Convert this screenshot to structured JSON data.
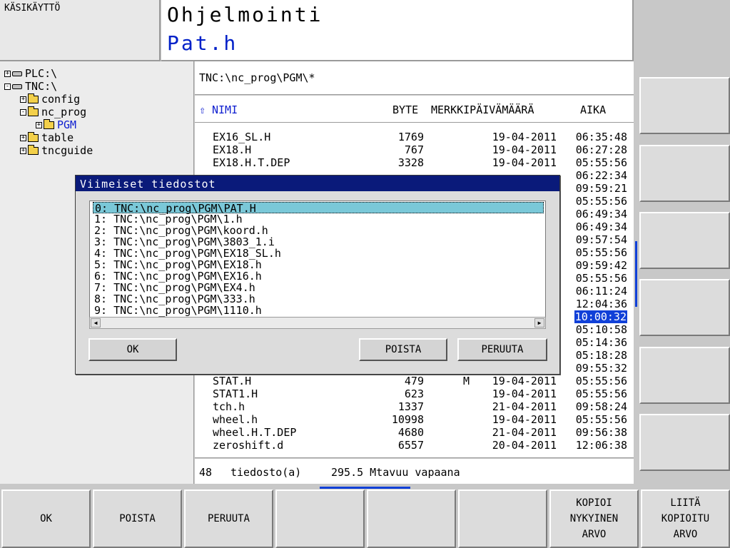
{
  "header": {
    "mode": "KÄSIKÄYTTÖ",
    "title": "Ohjelmointi",
    "subtitle": "Pat.h"
  },
  "tree": [
    {
      "label": "PLC:\\",
      "type": "drive",
      "level": 0,
      "toggle": "+"
    },
    {
      "label": "TNC:\\",
      "type": "drive",
      "level": 0,
      "toggle": "-"
    },
    {
      "label": "config",
      "type": "folder",
      "level": 1,
      "toggle": "+"
    },
    {
      "label": "nc_prog",
      "type": "folder",
      "level": 1,
      "toggle": "-"
    },
    {
      "label": "PGM",
      "type": "folder",
      "level": 2,
      "toggle": "+",
      "selected": true
    },
    {
      "label": "table",
      "type": "folder",
      "level": 1,
      "toggle": "+"
    },
    {
      "label": "tncguide",
      "type": "folder",
      "level": 1,
      "toggle": "+"
    }
  ],
  "path": "TNC:\\nc_prog\\PGM\\*",
  "columns": {
    "name": "NIMI",
    "byte": "BYTE",
    "flag_date": "MERKKIPÄIVÄMÄÄRÄ",
    "time": "AIKA"
  },
  "files": [
    {
      "name": "EX16_SL.H",
      "byte": "1769",
      "flag": "",
      "date": "19-04-2011",
      "time": "06:35:48"
    },
    {
      "name": "EX18.H",
      "byte": "767",
      "flag": "",
      "date": "19-04-2011",
      "time": "06:27:28"
    },
    {
      "name": "EX18.H.T.DEP",
      "byte": "3328",
      "flag": "",
      "date": "19-04-2011",
      "time": "05:55:56"
    },
    {
      "name": "",
      "byte": "",
      "flag": "",
      "date": "",
      "time": "06:22:34"
    },
    {
      "name": "",
      "byte": "",
      "flag": "",
      "date": "",
      "time": "09:59:21"
    },
    {
      "name": "",
      "byte": "",
      "flag": "",
      "date": "",
      "time": "05:55:56"
    },
    {
      "name": "",
      "byte": "",
      "flag": "",
      "date": "",
      "time": "06:49:34"
    },
    {
      "name": "",
      "byte": "",
      "flag": "",
      "date": "",
      "time": "06:49:34"
    },
    {
      "name": "",
      "byte": "",
      "flag": "",
      "date": "",
      "time": "09:57:54"
    },
    {
      "name": "",
      "byte": "",
      "flag": "",
      "date": "",
      "time": "05:55:56"
    },
    {
      "name": "",
      "byte": "",
      "flag": "",
      "date": "",
      "time": "09:59:42"
    },
    {
      "name": "",
      "byte": "",
      "flag": "",
      "date": "",
      "time": "05:55:56"
    },
    {
      "name": "",
      "byte": "",
      "flag": "",
      "date": "",
      "time": "06:11:24"
    },
    {
      "name": "",
      "byte": "",
      "flag": "",
      "date": "",
      "time": "12:04:36"
    },
    {
      "name": "",
      "byte": "",
      "flag": "",
      "date": "",
      "time": "10:00:32",
      "highlight": true
    },
    {
      "name": "",
      "byte": "",
      "flag": "",
      "date": "",
      "time": "05:10:58"
    },
    {
      "name": "",
      "byte": "",
      "flag": "",
      "date": "",
      "time": "05:14:36"
    },
    {
      "name": "",
      "byte": "",
      "flag": "",
      "date": "",
      "time": "05:18:28"
    },
    {
      "name": "",
      "byte": "",
      "flag": "",
      "date": "",
      "time": "09:55:32"
    },
    {
      "name": "STAT.H",
      "byte": "479",
      "flag": "M",
      "date": "19-04-2011",
      "time": "05:55:56"
    },
    {
      "name": "STAT1.H",
      "byte": "623",
      "flag": "",
      "date": "19-04-2011",
      "time": "05:55:56"
    },
    {
      "name": "tch.h",
      "byte": "1337",
      "flag": "",
      "date": "21-04-2011",
      "time": "09:58:24"
    },
    {
      "name": "wheel.h",
      "byte": "10998",
      "flag": "",
      "date": "19-04-2011",
      "time": "05:55:56"
    },
    {
      "name": "wheel.H.T.DEP",
      "byte": "4680",
      "flag": "",
      "date": "21-04-2011",
      "time": "09:56:38"
    },
    {
      "name": "zeroshift.d",
      "byte": "6557",
      "flag": "",
      "date": "20-04-2011",
      "time": "12:06:38"
    }
  ],
  "status": {
    "count": "48",
    "files_label": "tiedosto(a)",
    "free": "295.5 Mtavuu vapaana"
  },
  "dialog": {
    "title": "Viimeiset tiedostot",
    "items": [
      "0: TNC:\\nc_prog\\PGM\\PAT.H",
      "1: TNC:\\nc_prog\\PGM\\1.h",
      "2: TNC:\\nc_prog\\PGM\\koord.h",
      "3: TNC:\\nc_prog\\PGM\\3803_1.i",
      "4: TNC:\\nc_prog\\PGM\\EX18_SL.h",
      "5: TNC:\\nc_prog\\PGM\\EX18.h",
      "6: TNC:\\nc_prog\\PGM\\EX16.h",
      "7: TNC:\\nc_prog\\PGM\\EX4.h",
      "8: TNC:\\nc_prog\\PGM\\333.h",
      "9: TNC:\\nc_prog\\PGM\\1110.h"
    ],
    "selected_index": 0,
    "ok_label": "OK",
    "delete_label": "POISTA",
    "cancel_label": "PERUUTA"
  },
  "softkeys": [
    "OK",
    "POISTA",
    "PERUUTA",
    "",
    "",
    "",
    "KOPIOI\nNYKYINEN\nARVO",
    "LIITÄ\nKOPIOITU\nARVO"
  ],
  "colors": {
    "accent": "#1040d8",
    "dialog_title_bg": "#0a1a7a",
    "selection_bg": "#7ac8d8",
    "folder": "#f3d04a"
  }
}
